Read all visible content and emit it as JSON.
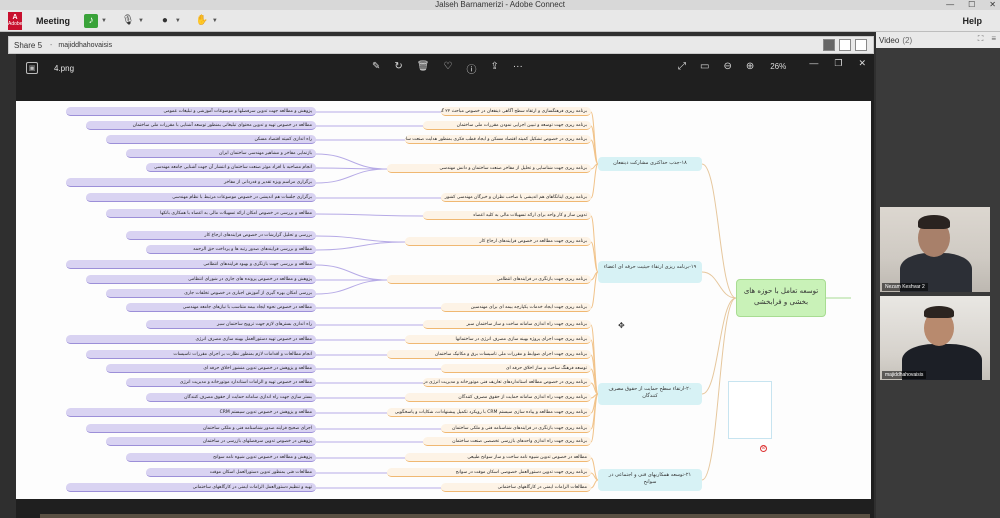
{
  "window": {
    "title": "Jalseh Barnamerizi - Adobe Connect",
    "controls": [
      "—",
      "☐",
      "✕"
    ]
  },
  "menubar": {
    "logo_text": "Adobe",
    "logo_letter": "A",
    "meeting_label": "Meeting",
    "help_label": "Help"
  },
  "share_pod": {
    "title": "Share 5",
    "separator": "-",
    "presenter": "majiddhahovaisis"
  },
  "video_pod": {
    "title": "Video",
    "count": "(2)",
    "cams": [
      {
        "name": "Nezam Keshvar 2"
      },
      {
        "name": "majiddhahovaisis"
      }
    ]
  },
  "viewer": {
    "file_name": "4.png",
    "zoom": "26%",
    "tools": [
      "edit-icon",
      "rotate-icon",
      "delete-icon",
      "heart-icon",
      "info-icon",
      "share-icon",
      "more-icon"
    ]
  },
  "mindmap": {
    "root": "توسعه تعامل با حوزه های بخشی و فرابخشی",
    "branches": [
      {
        "label": "۱۸-جذب حداکثری مشارکت ذینفعان"
      },
      {
        "label": "۱۹-برنامه ریزی ارتقاء حیثیت حرفه ای اعضاء"
      },
      {
        "label": "۲۰-ارتقاء سطح حمایت از حقوق مصرف کنندگان"
      },
      {
        "label": "۲۱-توسعه همکاریهای فنی و اجتماعی در سوانح"
      }
    ],
    "mid_items": [
      "برنامه ریزی فرهنگسازی و ارتقاء سطح آگاهی ذینفعان در خصوص مباحث ۲۲ گانه",
      "برنامه ریزی جهت توسعه و تبیین اجرایی نمودن مقررات ملی ساختمان",
      "برنامه ریزی در خصوص تشکیل کمیته اقتصاد مسکن و ایجاد قطب فکری بمنظور هدایت صنعت ساختمان جهت ارتقاء منافع ذینفعان",
      "برنامه ریزی جهت شناسایی و تحلیل از مفاخر صنعت ساختمان و دانش مهندسی",
      "برنامه ریزی اینانگاهای هم اندیشی با صاحب نظران و خبرگان مهندسی کشور",
      "تدوین ساز و کار واحد برای ارائه تسهیلات مالی به کلیه اعضاء",
      "برنامه ریزی جهت مطالعه در خصوص فرایندهای ارجاع کار",
      "برنامه ریزی جهت بازنگری در فرایندهای انتظامی",
      "برنامه ریزی جهت ایجاد خدمات یکپارچه بیمه ای برای مهندسین",
      "برنامه ریزی جهت راه اندازی سامانه ساخت و ساز ساختمان سبز",
      "برنامه ریزی جهت اجرای پروژه بهینه سازی مصرف انرژی در ساختمانها",
      "برنامه ریزی جهت اجرای ضوابط و مقررات ملی تاسیسات برق و مکانیک ساختمان",
      "توسعه فرهنگ ساخت و ساز اخلاق حرفه ای",
      "برنامه ریزی در خصوص مطالعه استانداردهای تعاریف فنی موتورخانه و مدیریت انرژی در ساختمانها",
      "برنامه ریزی جهت راه اندازی سامانه حمایت از حقوق مصرف کنندگان",
      "برنامه ریزی جهت مطالعه و پیاده سازی سیستم CRM با رویکرد تکمیل پیشنهادات، شکایات و پاسخگویی",
      "برنامه ریزی جهت بازنگری در فرایندهای شناسنامه فنی و ملکی ساختمان",
      "برنامه ریزی جهت راه اندازی واحدهای بازرسی تخصصی صنعت ساختمان",
      "مطالعه در خصوص تدوین شیوه نامه ساخت و ساز سوانح طبیعی",
      "برنامه ریزی جهت تدوین دستورالعمل خصوصی اسکان موقت در سوانح",
      "مطالعات الزامات ایمنی در کارگاههای ساختمانی"
    ],
    "leaves": [
      "پژوهش و مطالعه جهت تدوین سرفصلها و موضوعات آموزشی و تبلیغات عمومی",
      "مطالعه در خصوص تهیه و تدوین محتوای تبلیغاتی بمنظور توسعه آشنایی با مقررات ملی ساختمان",
      "راه اندازی کمیته اقتصاد مسکن",
      "بازنمایی مفاخر و مشاهیر مهندسی ساختمان ایران",
      "انجام مصاحبه با افراد موثر صنعت ساختمان و انتشار آن جهت آشنایی جامعه مهندسی",
      "برگزاری مراسم ویژه تقدیر و قدردانی از مفاخر",
      "برگزاری جلسات هم اندیشی در خصوص موضوعات مرتبط با نظام مهندسی",
      "مطالعه و بررسی در خصوص امکان ارائه تسهیلات مالی به اعضاء با همکاری بانکها",
      "بررسی و تحلیل گزارشات در خصوص فرایندهای ارجاع کار",
      "مطالعه و بررسی فرایندهای صدور رتبه ها و پرداخت حق الزحمه",
      "مطالعه و بررسی جهت بازنگری و بهبود فرایندهای انتظامی",
      "پژوهش و مطالعه در خصوص پرونده های جاری در شورای انتظامی",
      "بررسی امکان بهره گیری از آموزش اجباری در خصوص تخلفات جاری",
      "مطالعه در خصوص نحوه ایجاد بیمه متناسب با نیازهای جامعه مهندسی",
      "راه اندازی بسترهای لازم جهت ترویج ساختمان سبز",
      "مطالعه در خصوص تهیه دستورالعمل بهینه سازی مصرف انرژی",
      "انجام مطالعات و اقدامات لازم بمنظور نظارت بر اجرای مقررات تاسیسات",
      "مطالعه و پژوهش در خصوص تدوین منشور اخلاق حرفه ای",
      "مطالعه در خصوص تهیه و الزامات استاندارد موتورخانه و مدیریت انرژی",
      "بستر سازی جهت راه اندازی سامانه حمایت از حقوق مصرف کنندگان",
      "مطالعه و پژوهش در خصوص تدوین سیستم CRM",
      "اجرای صحیح فرایند صدور شناسنامه فنی و ملکی ساختمان",
      "پژوهش در خصوص تدوین سرفصلهای بازرسی در ساختمان",
      "پژوهش و مطالعه در خصوص تدوین شیوه نامه سوانح",
      "مطالعات فنی بمنظور تدوین دستورالعمل اسکان موقت",
      "تهیه و تنظیم دستورالعمل الزامات ایمنی در کارگاههای ساختمانی"
    ]
  }
}
